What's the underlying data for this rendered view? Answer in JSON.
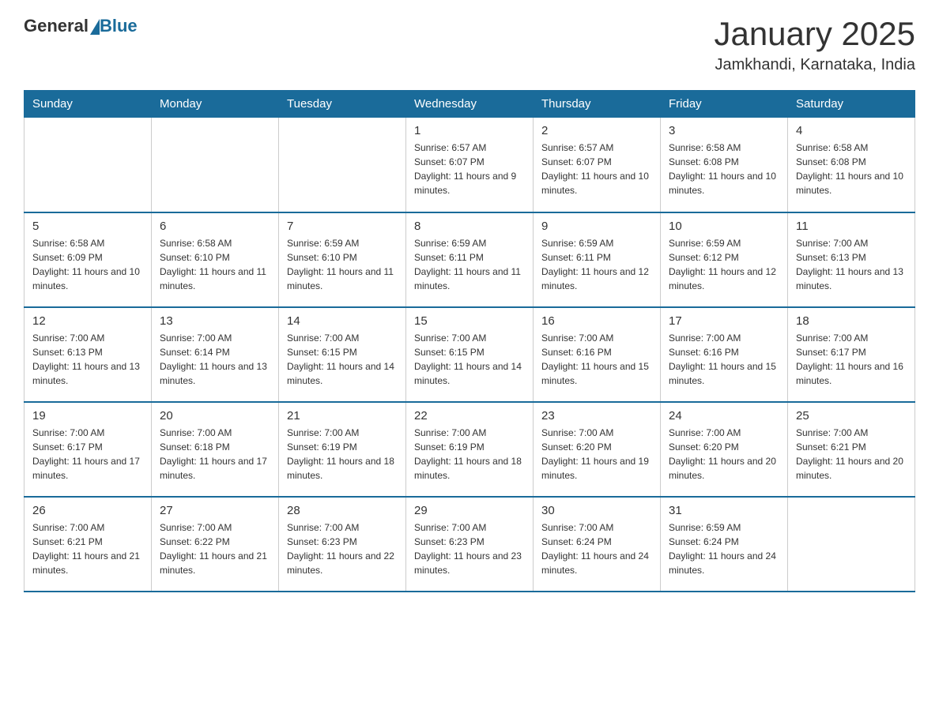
{
  "header": {
    "logo_general": "General",
    "logo_blue": "Blue",
    "title": "January 2025",
    "subtitle": "Jamkhandi, Karnataka, India"
  },
  "weekdays": [
    "Sunday",
    "Monday",
    "Tuesday",
    "Wednesday",
    "Thursday",
    "Friday",
    "Saturday"
  ],
  "weeks": [
    [
      {
        "day": "",
        "sunrise": "",
        "sunset": "",
        "daylight": ""
      },
      {
        "day": "",
        "sunrise": "",
        "sunset": "",
        "daylight": ""
      },
      {
        "day": "",
        "sunrise": "",
        "sunset": "",
        "daylight": ""
      },
      {
        "day": "1",
        "sunrise": "Sunrise: 6:57 AM",
        "sunset": "Sunset: 6:07 PM",
        "daylight": "Daylight: 11 hours and 9 minutes."
      },
      {
        "day": "2",
        "sunrise": "Sunrise: 6:57 AM",
        "sunset": "Sunset: 6:07 PM",
        "daylight": "Daylight: 11 hours and 10 minutes."
      },
      {
        "day": "3",
        "sunrise": "Sunrise: 6:58 AM",
        "sunset": "Sunset: 6:08 PM",
        "daylight": "Daylight: 11 hours and 10 minutes."
      },
      {
        "day": "4",
        "sunrise": "Sunrise: 6:58 AM",
        "sunset": "Sunset: 6:08 PM",
        "daylight": "Daylight: 11 hours and 10 minutes."
      }
    ],
    [
      {
        "day": "5",
        "sunrise": "Sunrise: 6:58 AM",
        "sunset": "Sunset: 6:09 PM",
        "daylight": "Daylight: 11 hours and 10 minutes."
      },
      {
        "day": "6",
        "sunrise": "Sunrise: 6:58 AM",
        "sunset": "Sunset: 6:10 PM",
        "daylight": "Daylight: 11 hours and 11 minutes."
      },
      {
        "day": "7",
        "sunrise": "Sunrise: 6:59 AM",
        "sunset": "Sunset: 6:10 PM",
        "daylight": "Daylight: 11 hours and 11 minutes."
      },
      {
        "day": "8",
        "sunrise": "Sunrise: 6:59 AM",
        "sunset": "Sunset: 6:11 PM",
        "daylight": "Daylight: 11 hours and 11 minutes."
      },
      {
        "day": "9",
        "sunrise": "Sunrise: 6:59 AM",
        "sunset": "Sunset: 6:11 PM",
        "daylight": "Daylight: 11 hours and 12 minutes."
      },
      {
        "day": "10",
        "sunrise": "Sunrise: 6:59 AM",
        "sunset": "Sunset: 6:12 PM",
        "daylight": "Daylight: 11 hours and 12 minutes."
      },
      {
        "day": "11",
        "sunrise": "Sunrise: 7:00 AM",
        "sunset": "Sunset: 6:13 PM",
        "daylight": "Daylight: 11 hours and 13 minutes."
      }
    ],
    [
      {
        "day": "12",
        "sunrise": "Sunrise: 7:00 AM",
        "sunset": "Sunset: 6:13 PM",
        "daylight": "Daylight: 11 hours and 13 minutes."
      },
      {
        "day": "13",
        "sunrise": "Sunrise: 7:00 AM",
        "sunset": "Sunset: 6:14 PM",
        "daylight": "Daylight: 11 hours and 13 minutes."
      },
      {
        "day": "14",
        "sunrise": "Sunrise: 7:00 AM",
        "sunset": "Sunset: 6:15 PM",
        "daylight": "Daylight: 11 hours and 14 minutes."
      },
      {
        "day": "15",
        "sunrise": "Sunrise: 7:00 AM",
        "sunset": "Sunset: 6:15 PM",
        "daylight": "Daylight: 11 hours and 14 minutes."
      },
      {
        "day": "16",
        "sunrise": "Sunrise: 7:00 AM",
        "sunset": "Sunset: 6:16 PM",
        "daylight": "Daylight: 11 hours and 15 minutes."
      },
      {
        "day": "17",
        "sunrise": "Sunrise: 7:00 AM",
        "sunset": "Sunset: 6:16 PM",
        "daylight": "Daylight: 11 hours and 15 minutes."
      },
      {
        "day": "18",
        "sunrise": "Sunrise: 7:00 AM",
        "sunset": "Sunset: 6:17 PM",
        "daylight": "Daylight: 11 hours and 16 minutes."
      }
    ],
    [
      {
        "day": "19",
        "sunrise": "Sunrise: 7:00 AM",
        "sunset": "Sunset: 6:17 PM",
        "daylight": "Daylight: 11 hours and 17 minutes."
      },
      {
        "day": "20",
        "sunrise": "Sunrise: 7:00 AM",
        "sunset": "Sunset: 6:18 PM",
        "daylight": "Daylight: 11 hours and 17 minutes."
      },
      {
        "day": "21",
        "sunrise": "Sunrise: 7:00 AM",
        "sunset": "Sunset: 6:19 PM",
        "daylight": "Daylight: 11 hours and 18 minutes."
      },
      {
        "day": "22",
        "sunrise": "Sunrise: 7:00 AM",
        "sunset": "Sunset: 6:19 PM",
        "daylight": "Daylight: 11 hours and 18 minutes."
      },
      {
        "day": "23",
        "sunrise": "Sunrise: 7:00 AM",
        "sunset": "Sunset: 6:20 PM",
        "daylight": "Daylight: 11 hours and 19 minutes."
      },
      {
        "day": "24",
        "sunrise": "Sunrise: 7:00 AM",
        "sunset": "Sunset: 6:20 PM",
        "daylight": "Daylight: 11 hours and 20 minutes."
      },
      {
        "day": "25",
        "sunrise": "Sunrise: 7:00 AM",
        "sunset": "Sunset: 6:21 PM",
        "daylight": "Daylight: 11 hours and 20 minutes."
      }
    ],
    [
      {
        "day": "26",
        "sunrise": "Sunrise: 7:00 AM",
        "sunset": "Sunset: 6:21 PM",
        "daylight": "Daylight: 11 hours and 21 minutes."
      },
      {
        "day": "27",
        "sunrise": "Sunrise: 7:00 AM",
        "sunset": "Sunset: 6:22 PM",
        "daylight": "Daylight: 11 hours and 21 minutes."
      },
      {
        "day": "28",
        "sunrise": "Sunrise: 7:00 AM",
        "sunset": "Sunset: 6:23 PM",
        "daylight": "Daylight: 11 hours and 22 minutes."
      },
      {
        "day": "29",
        "sunrise": "Sunrise: 7:00 AM",
        "sunset": "Sunset: 6:23 PM",
        "daylight": "Daylight: 11 hours and 23 minutes."
      },
      {
        "day": "30",
        "sunrise": "Sunrise: 7:00 AM",
        "sunset": "Sunset: 6:24 PM",
        "daylight": "Daylight: 11 hours and 24 minutes."
      },
      {
        "day": "31",
        "sunrise": "Sunrise: 6:59 AM",
        "sunset": "Sunset: 6:24 PM",
        "daylight": "Daylight: 11 hours and 24 minutes."
      },
      {
        "day": "",
        "sunrise": "",
        "sunset": "",
        "daylight": ""
      }
    ]
  ]
}
